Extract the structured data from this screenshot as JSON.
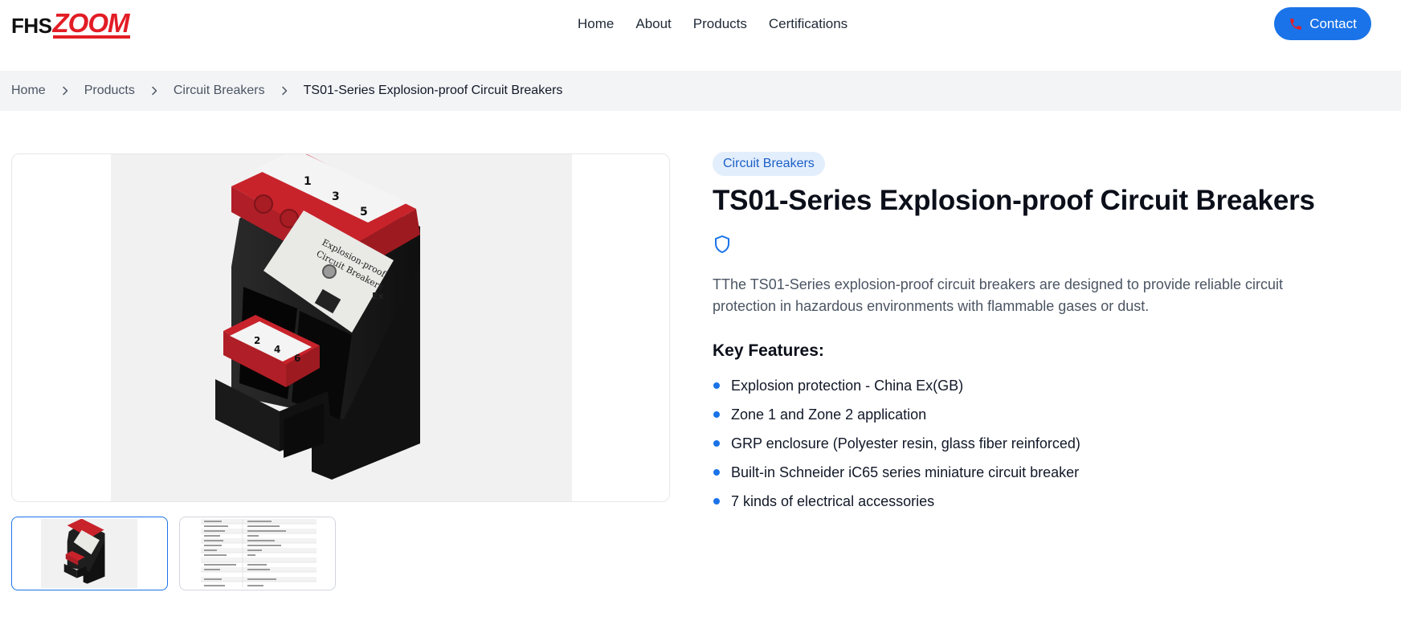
{
  "brand": {
    "logo_part1": "FHS",
    "logo_part2": "ZOOM"
  },
  "nav": {
    "items": [
      {
        "label": "Home"
      },
      {
        "label": "About"
      },
      {
        "label": "Products"
      },
      {
        "label": "Certifications"
      }
    ]
  },
  "contact": {
    "label": "Contact",
    "icon": "phone-icon"
  },
  "breadcrumb": {
    "items": [
      "Home",
      "Products",
      "Circuit Breakers"
    ],
    "current": "TS01-Series Explosion-proof Circuit Breakers"
  },
  "product": {
    "category_badge": "Circuit Breakers",
    "title": "TS01-Series Explosion-proof Circuit Breakers",
    "description": "TThe TS01-Series explosion-proof circuit breakers are designed to provide reliable circuit protection in hazardous environments with flammable gases or dust.",
    "features_heading": "Key Features:",
    "features": [
      "Explosion protection - China Ex(GB)",
      "Zone 1 and Zone 2 application",
      "GRP enclosure (Polyester resin, glass fiber reinforced)",
      "Built-in Schneider iC65 series miniature circuit breaker",
      "7 kinds of electrical accessories"
    ],
    "label_numbers_top": [
      "1",
      "3",
      "5"
    ],
    "label_numbers_bottom": [
      "2",
      "4",
      "6"
    ],
    "product_label_text": [
      "Explosion-proof",
      "Circuit Breakers"
    ],
    "label_mark": "Ex"
  },
  "gallery": {
    "selected_index": 0,
    "thumbnail_count": 2
  },
  "colors": {
    "accent": "#1a73e8",
    "brand_red": "#e21d25",
    "breadcrumb_bg": "#f3f4f6",
    "badge_bg": "#e3eefc"
  }
}
